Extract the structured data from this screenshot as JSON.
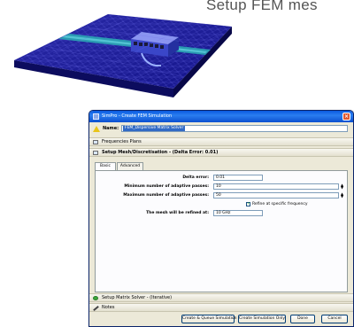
{
  "caption": "Setup FEM mes",
  "window": {
    "title": "SimPro - Create FEM Simulation",
    "close_glyph": "×"
  },
  "name_field": {
    "label": "Name:",
    "value": "FEM_Dispersive Matrix Solver"
  },
  "sections": {
    "frequencies": "Frequencies Plans",
    "mesh": "Setup Mesh/Discretisation - (Delta Error: 0.01)",
    "matrix_solver": "Setup Matrix Solver - (Iterative)",
    "notes": "Notes"
  },
  "tabs": [
    "Basic",
    "Advanced"
  ],
  "form": {
    "delta_error_label": "Delta error:",
    "delta_error_value": "0.01",
    "min_passes_label": "Minimum number of adaptive passes:",
    "min_passes_value": "10",
    "max_passes_label": "Maximum number of adaptive passes:",
    "max_passes_value": "50",
    "refine_checkbox_label": "Refine at specific frequency",
    "refine_checked": true,
    "refined_at_label": "The mesh will be refined at:",
    "refined_at_value": "10 GHz"
  },
  "buttons": {
    "create_queue": "Create & Queue Simulation",
    "create_only": "Create Simulation Only",
    "done": "Done",
    "cancel": "Cancel"
  },
  "colors": {
    "mesh_base": "#1c1c8a",
    "mesh_strip": "#2aa6b4",
    "titlebar": "#0a5ae0",
    "warning_icon": "#e8c41a"
  },
  "icons": {
    "warning": "warning-triangle-icon",
    "close": "close-icon",
    "checkbox": "checkmark-icon"
  }
}
